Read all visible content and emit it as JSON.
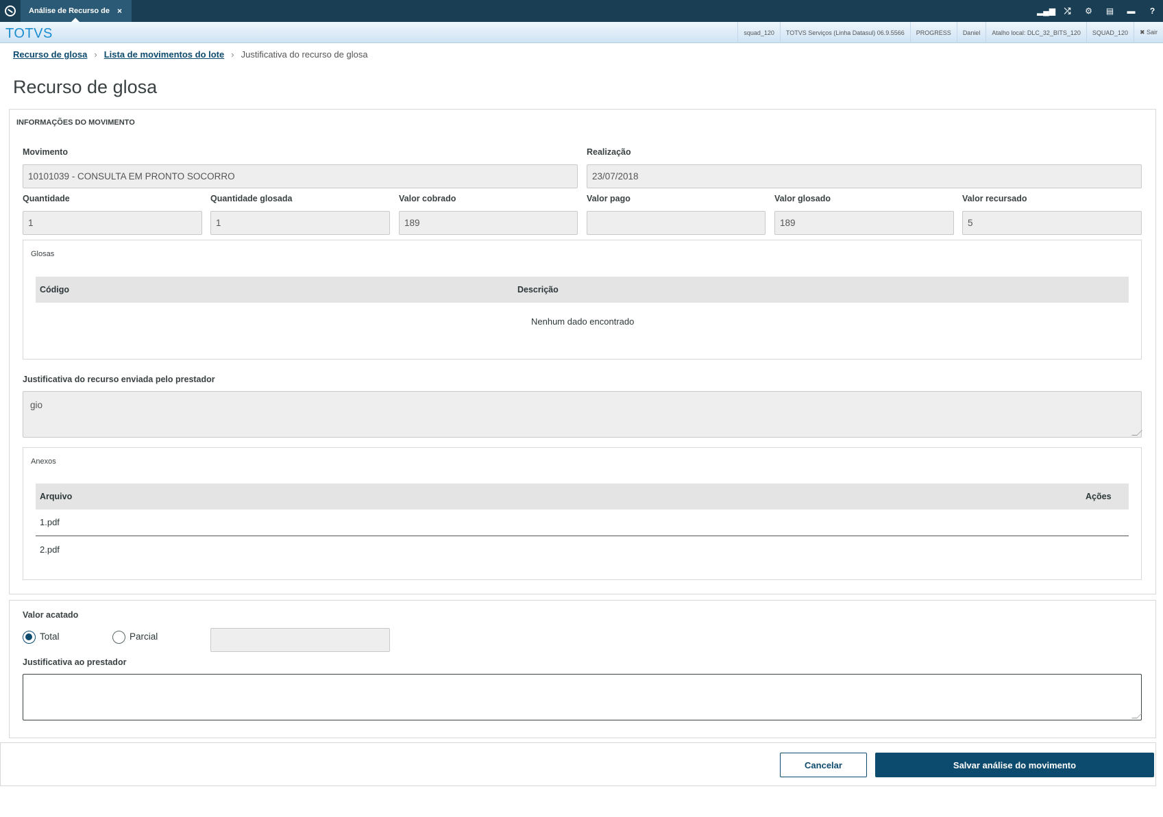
{
  "window": {
    "tab_label": "Análise de Recurso de",
    "tab_close": "×",
    "top_icons": [
      "signal-icon",
      "shuffle-icon",
      "gear-icon",
      "document-icon",
      "chat-icon",
      "help-icon"
    ],
    "top_icon_glyphs": [
      "▂▄▆",
      "⤮",
      "⚙",
      "▤",
      "▬",
      "?"
    ]
  },
  "infobar": {
    "brand": "TOTVS",
    "items": [
      "squad_120",
      "TOTVS Serviços (Linha Datasul) 06.9.5566",
      "PROGRESS",
      "Daniel",
      "Atalho local: DLC_32_BITS_120",
      "SQUAD_120"
    ],
    "exit": "✖ Sair"
  },
  "breadcrumb": {
    "items": [
      "Recurso de glosa",
      "Lista de movimentos do lote"
    ],
    "current": "Justificativa do recurso de glosa",
    "separator": "›"
  },
  "page_title": "Recurso de glosa",
  "movement": {
    "section_title": "INFORMAÇÕES DO MOVIMENTO",
    "movimento_label": "Movimento",
    "movimento_value": "10101039 - CONSULTA EM PRONTO SOCORRO",
    "realizacao_label": "Realização",
    "realizacao_value": "23/07/2018",
    "quantidade_label": "Quantidade",
    "quantidade_value": "1",
    "quantidade_glosada_label": "Quantidade glosada",
    "quantidade_glosada_value": "1",
    "valor_cobrado_label": "Valor cobrado",
    "valor_cobrado_value": "189",
    "valor_pago_label": "Valor pago",
    "valor_pago_value": "",
    "valor_glosado_label": "Valor glosado",
    "valor_glosado_value": "189",
    "valor_recursado_label": "Valor recursado",
    "valor_recursado_value": "5"
  },
  "glosas": {
    "title": "Glosas",
    "columns": [
      "Código",
      "Descrição"
    ],
    "empty_message": "Nenhum dado encontrado"
  },
  "justificativa_prestador": {
    "label": "Justificativa do recurso enviada pelo prestador",
    "value": "gio"
  },
  "anexos": {
    "title": "Anexos",
    "columns": [
      "Arquivo",
      "Ações"
    ],
    "rows": [
      "1.pdf",
      "2.pdf"
    ]
  },
  "analise": {
    "valor_acatado_label": "Valor acatado",
    "option_total": "Total",
    "option_parcial": "Parcial",
    "selected": "Total",
    "parcial_value": "",
    "justificativa_label": "Justificativa ao prestador",
    "justificativa_value": ""
  },
  "footer": {
    "cancel_label": "Cancelar",
    "save_label": "Salvar análise do movimento"
  },
  "colors": {
    "topbar": "#1a3f55",
    "primary": "#0c4a6e",
    "brand": "#1b8dd0",
    "field_bg": "#eeeeee"
  }
}
